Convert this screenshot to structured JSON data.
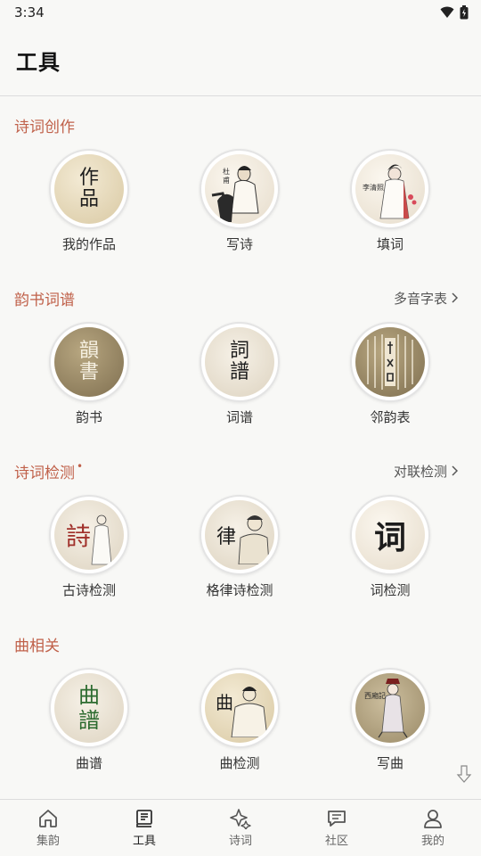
{
  "status": {
    "time": "3:34"
  },
  "header": {
    "title": "工具"
  },
  "sections": [
    {
      "title": "诗词创作",
      "link": "",
      "items": [
        {
          "label": "我的作品",
          "art": "作品"
        },
        {
          "label": "写诗",
          "art": ""
        },
        {
          "label": "填词",
          "art": ""
        }
      ]
    },
    {
      "title": "韵书词谱",
      "link": "多音字表",
      "items": [
        {
          "label": "韵书",
          "art": "韻書"
        },
        {
          "label": "词谱",
          "art": "詞譜"
        },
        {
          "label": "邻韵表",
          "art": ""
        }
      ]
    },
    {
      "title": "诗词检测",
      "link": "对联检测",
      "items": [
        {
          "label": "古诗检测",
          "art": "詩"
        },
        {
          "label": "格律诗检测",
          "art": "律"
        },
        {
          "label": "词检测",
          "art": "词"
        }
      ]
    },
    {
      "title": "曲相关",
      "link": "",
      "items": [
        {
          "label": "曲谱",
          "art": "曲譜"
        },
        {
          "label": "曲检测",
          "art": "曲"
        },
        {
          "label": "写曲",
          "art": ""
        }
      ]
    }
  ],
  "tabs": [
    {
      "label": "集韵",
      "icon": "home-icon"
    },
    {
      "label": "工具",
      "icon": "book-icon",
      "active": true
    },
    {
      "label": "诗词",
      "icon": "sparkle-icon"
    },
    {
      "label": "社区",
      "icon": "chat-icon"
    },
    {
      "label": "我的",
      "icon": "person-icon"
    }
  ],
  "colors": {
    "accent": "#c0614a",
    "background": "#f8f8f6"
  }
}
